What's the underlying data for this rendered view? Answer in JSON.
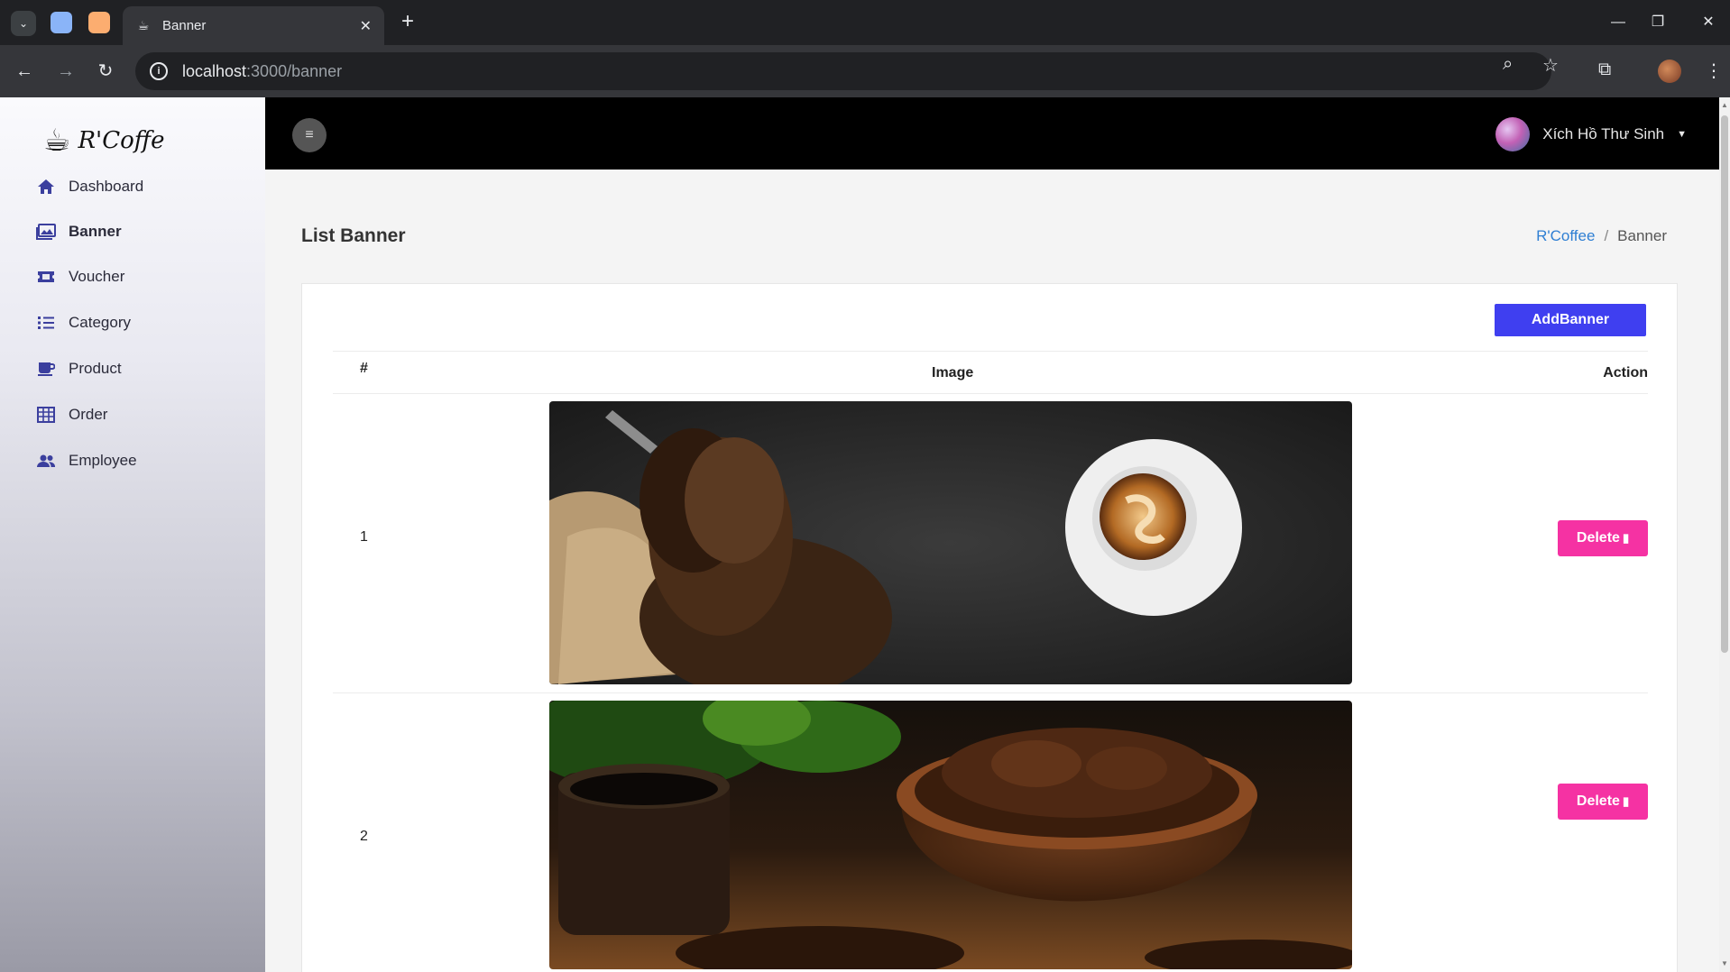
{
  "browser": {
    "tab_title": "Banner",
    "url_host": "localhost",
    "url_path": ":3000/banner"
  },
  "sidebar": {
    "brand": "R'Coffe",
    "items": [
      {
        "label": "Dashboard",
        "icon": "home-icon"
      },
      {
        "label": "Banner",
        "icon": "image-gallery-icon",
        "active": true
      },
      {
        "label": "Voucher",
        "icon": "ticket-icon"
      },
      {
        "label": "Category",
        "icon": "list-icon"
      },
      {
        "label": "Product",
        "icon": "coffee-mug-icon"
      },
      {
        "label": "Order",
        "icon": "table-grid-icon"
      },
      {
        "label": "Employee",
        "icon": "users-icon"
      }
    ]
  },
  "header": {
    "user_name": "Xích Hồ Thư Sinh"
  },
  "page": {
    "title": "List Banner",
    "breadcrumb": {
      "root": "R'Coffee",
      "separator": "/",
      "current": "Banner"
    },
    "add_button": "AddBanner"
  },
  "table": {
    "columns": [
      "#",
      "Image",
      "Action"
    ],
    "rows": [
      {
        "num": "1",
        "image": "coffee beans in scoop with burlap sack and espresso cup on dark slate",
        "action": "Delete"
      },
      {
        "num": "2",
        "image": "cup of black coffee beside bowl of roasted coffee beans on wooden table",
        "action": "Delete"
      }
    ]
  },
  "colors": {
    "primary_button": "#3f3ff0",
    "delete_button": "#f532a3",
    "breadcrumb_link": "#2f7fd3",
    "header_bg": "#000000",
    "sidebar_icon": "#3b3f9e"
  }
}
